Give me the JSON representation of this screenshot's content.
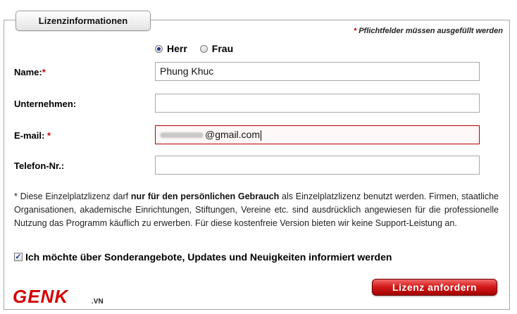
{
  "section": {
    "title": "Lizenzinformationen"
  },
  "required_note": {
    "asterisk": "*",
    "text": "Pflichtfelder müssen ausgefüllt werden"
  },
  "salutation": {
    "options": [
      {
        "label": "Herr",
        "checked": true
      },
      {
        "label": "Frau",
        "checked": false
      }
    ]
  },
  "fields": {
    "name": {
      "label": "Name:",
      "required_mark": "*",
      "value": "Phung Khuc"
    },
    "company": {
      "label": "Unternehmen:",
      "value": ""
    },
    "email": {
      "label": "E-mail:",
      "required_mark": "*",
      "value_visible": "@gmail.com"
    },
    "phone": {
      "label": "Telefon-Nr.:",
      "value": ""
    }
  },
  "notice": {
    "prefix": "* Diese Einzelplatzlizenz darf ",
    "emphasis": "nur für den persönlichen Gebrauch",
    "suffix": " als Einzelplatzlizenz benutzt werden. Firmen, staatliche Organisationen, akademische Einrichtungen, Stiftungen, Vereine etc. sind ausdrücklich angewiesen für die professionelle Nutzung das Programm käuflich zu erwerben. Für diese kostenfreie Version bieten wir keine Support-Leistung an."
  },
  "newsletter": {
    "label": "Ich möchte über Sonderangebote, Updates und Neuigkeiten informiert werden",
    "checked": true,
    "check_glyph": "✓"
  },
  "logo": {
    "text": "GENK",
    "suffix": ".VN"
  },
  "submit": {
    "label": "Lizenz anfordern"
  },
  "colors": {
    "required": "#cc0000",
    "button": "#c00000",
    "error_border": "#b80000"
  }
}
